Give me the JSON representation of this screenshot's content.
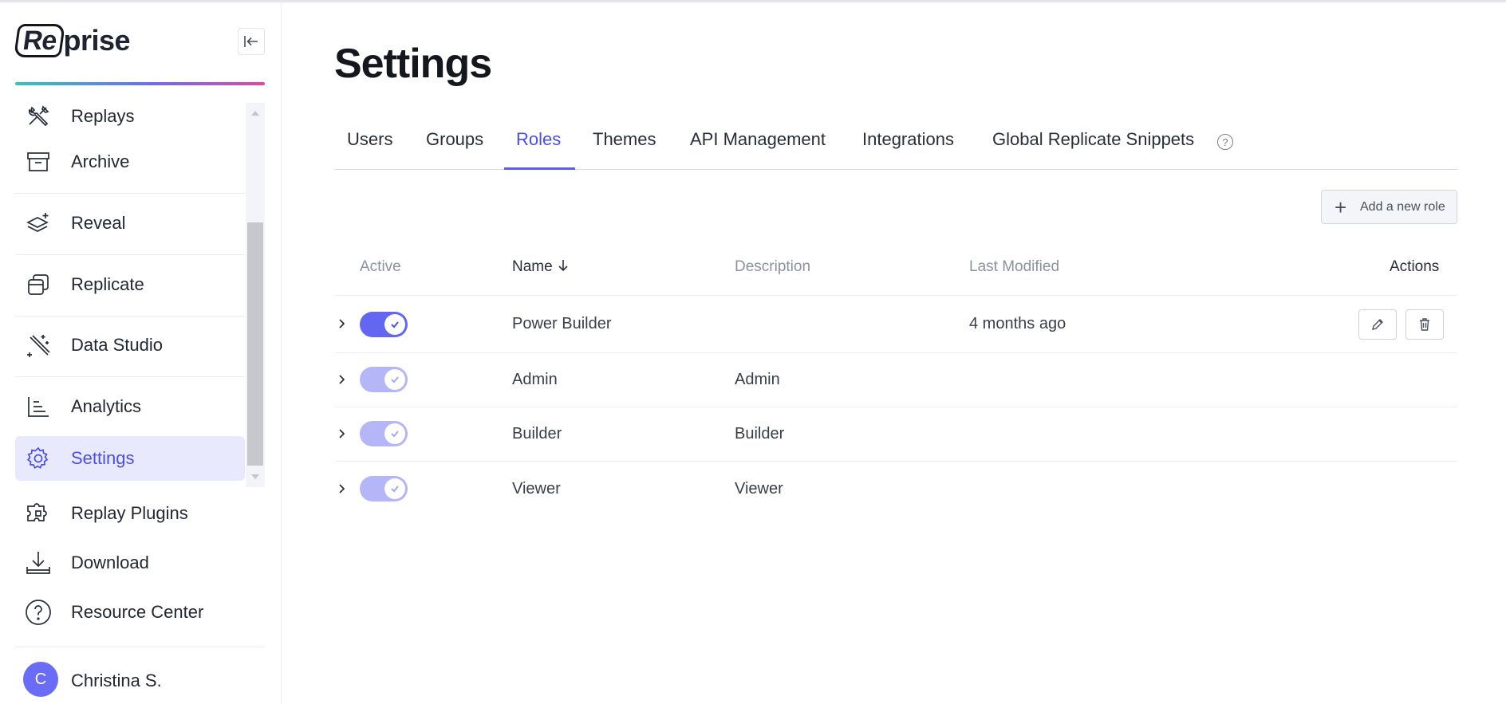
{
  "sidebar": {
    "logo": "Re/prise",
    "logo_boxed": "Re",
    "logo_rest": "prise",
    "items": [
      {
        "label": "Replays",
        "icon": "tools-icon"
      },
      {
        "label": "Archive",
        "icon": "archive-icon"
      },
      {
        "label": "Reveal",
        "icon": "layers-icon"
      },
      {
        "label": "Replicate",
        "icon": "copy-icon"
      },
      {
        "label": "Data Studio",
        "icon": "magic-wand-icon"
      },
      {
        "label": "Analytics",
        "icon": "bar-chart-icon"
      },
      {
        "label": "Settings",
        "icon": "gear-icon",
        "active": true
      }
    ],
    "lower_items": [
      {
        "label": "Replay Plugins",
        "icon": "puzzle-icon"
      },
      {
        "label": "Download",
        "icon": "download-icon"
      },
      {
        "label": "Resource Center",
        "icon": "help-circle-icon"
      }
    ],
    "user": {
      "initial": "C",
      "name": "Christina S."
    }
  },
  "main": {
    "title": "Settings",
    "tabs": [
      {
        "label": "Users"
      },
      {
        "label": "Groups"
      },
      {
        "label": "Roles",
        "active": true
      },
      {
        "label": "Themes"
      },
      {
        "label": "API Management"
      },
      {
        "label": "Integrations"
      },
      {
        "label": "Global Replicate Snippets"
      }
    ],
    "help_glyph": "?",
    "add_button": {
      "plus": "+",
      "label": "Add a new role"
    },
    "table": {
      "headers": {
        "active": "Active",
        "name": "Name",
        "description": "Description",
        "last_modified": "Last Modified",
        "actions": "Actions"
      },
      "rows": [
        {
          "name": "Power Builder",
          "description": "",
          "last_modified": "4 months ago",
          "active": true,
          "editable": true
        },
        {
          "name": "Admin",
          "description": "Admin",
          "last_modified": "",
          "active": true,
          "editable": false
        },
        {
          "name": "Builder",
          "description": "Builder",
          "last_modified": "",
          "active": true,
          "editable": false
        },
        {
          "name": "Viewer",
          "description": "Viewer",
          "last_modified": "",
          "active": true,
          "editable": false
        }
      ]
    }
  },
  "colors": {
    "accent": "#4b4ee8",
    "toggle_on": "#6366f1",
    "toggle_disabled": "#b4b6f8",
    "active_nav_bg": "#e9e9fd"
  }
}
